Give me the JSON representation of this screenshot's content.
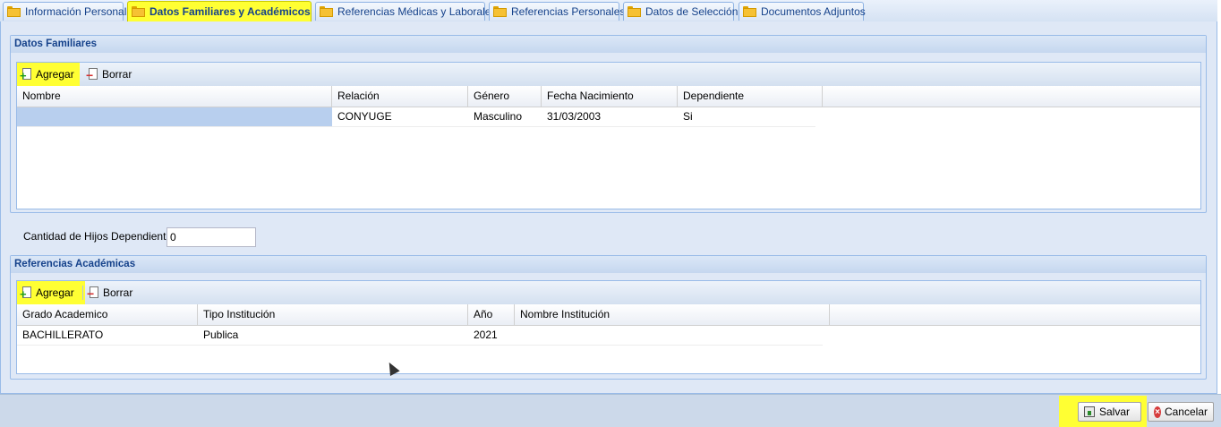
{
  "tabs": [
    {
      "label": "Información Personal",
      "active": false
    },
    {
      "label": "Datos Familiares y Académicos",
      "active": true
    },
    {
      "label": "Referencias Médicas y Laborales",
      "active": false
    },
    {
      "label": "Referencias Personales",
      "active": false
    },
    {
      "label": "Datos de Selección",
      "active": false
    },
    {
      "label": "Documentos Adjuntos",
      "active": false
    }
  ],
  "familiares": {
    "legend": "Datos Familiares",
    "add_label": "Agregar",
    "delete_label": "Borrar",
    "columns": [
      "Nombre",
      "Relación",
      "Género",
      "Fecha Nacimiento",
      "Dependiente"
    ],
    "rows": [
      {
        "nombre": "",
        "relacion": "CONYUGE",
        "genero": "Masculino",
        "fecha": "31/03/2003",
        "dependiente": "Si"
      }
    ]
  },
  "hijos": {
    "label": "Cantidad de Hijos Dependientes",
    "value": "0"
  },
  "academicas": {
    "legend": "Referencias Académicas",
    "add_label": "Agregar",
    "delete_label": "Borrar",
    "columns": [
      "Grado Academico",
      "Tipo Institución",
      "Año",
      "Nombre Institución"
    ],
    "rows": [
      {
        "grado": "BACHILLERATO",
        "tipo": "Publica",
        "anio": "2021",
        "nombre": ""
      }
    ]
  },
  "footer": {
    "save_label": "Salvar",
    "cancel_label": "Cancelar"
  },
  "colors": {
    "highlight": "#ffff33",
    "panel": "#dfe8f6",
    "accent": "#15428b"
  }
}
